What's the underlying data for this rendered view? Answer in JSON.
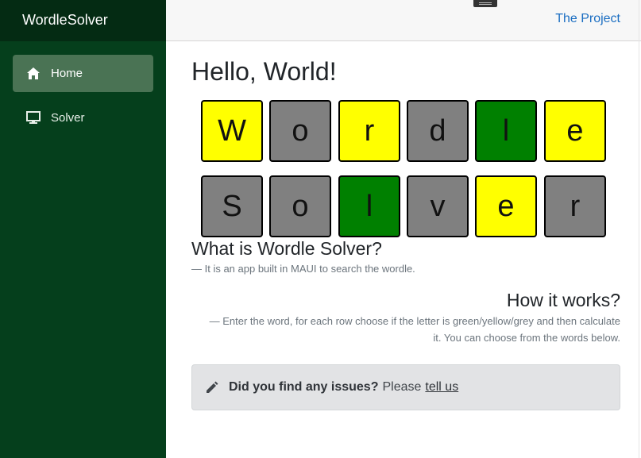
{
  "app": {
    "brand": "WordleSolver"
  },
  "sidebar": {
    "items": [
      {
        "label": "Home",
        "icon": "home-icon",
        "active": true
      },
      {
        "label": "Solver",
        "icon": "monitor-icon",
        "active": false
      }
    ]
  },
  "topbar": {
    "link": "The Project"
  },
  "main": {
    "title": "Hello, World!",
    "rows": [
      [
        {
          "letter": "W",
          "color": "#ffff00"
        },
        {
          "letter": "o",
          "color": "#808080"
        },
        {
          "letter": "r",
          "color": "#ffff00"
        },
        {
          "letter": "d",
          "color": "#808080"
        },
        {
          "letter": "l",
          "color": "#008000"
        },
        {
          "letter": "e",
          "color": "#ffff00"
        }
      ],
      [
        {
          "letter": "S",
          "color": "#808080"
        },
        {
          "letter": "o",
          "color": "#808080"
        },
        {
          "letter": "l",
          "color": "#008000"
        },
        {
          "letter": "v",
          "color": "#808080"
        },
        {
          "letter": "e",
          "color": "#ffff00"
        },
        {
          "letter": "r",
          "color": "#808080"
        }
      ]
    ],
    "what_title": "What is Wordle Solver?",
    "what_text": "— It is an app built in MAUI to search the wordle.",
    "how_title": "How it works?",
    "how_text": "— Enter the word, for each row choose if the letter is green/yellow/grey and then calculate it. You can choose from the words below.",
    "alert": {
      "strong": "Did you find any issues?",
      "text": "Please",
      "link": "tell us"
    }
  }
}
